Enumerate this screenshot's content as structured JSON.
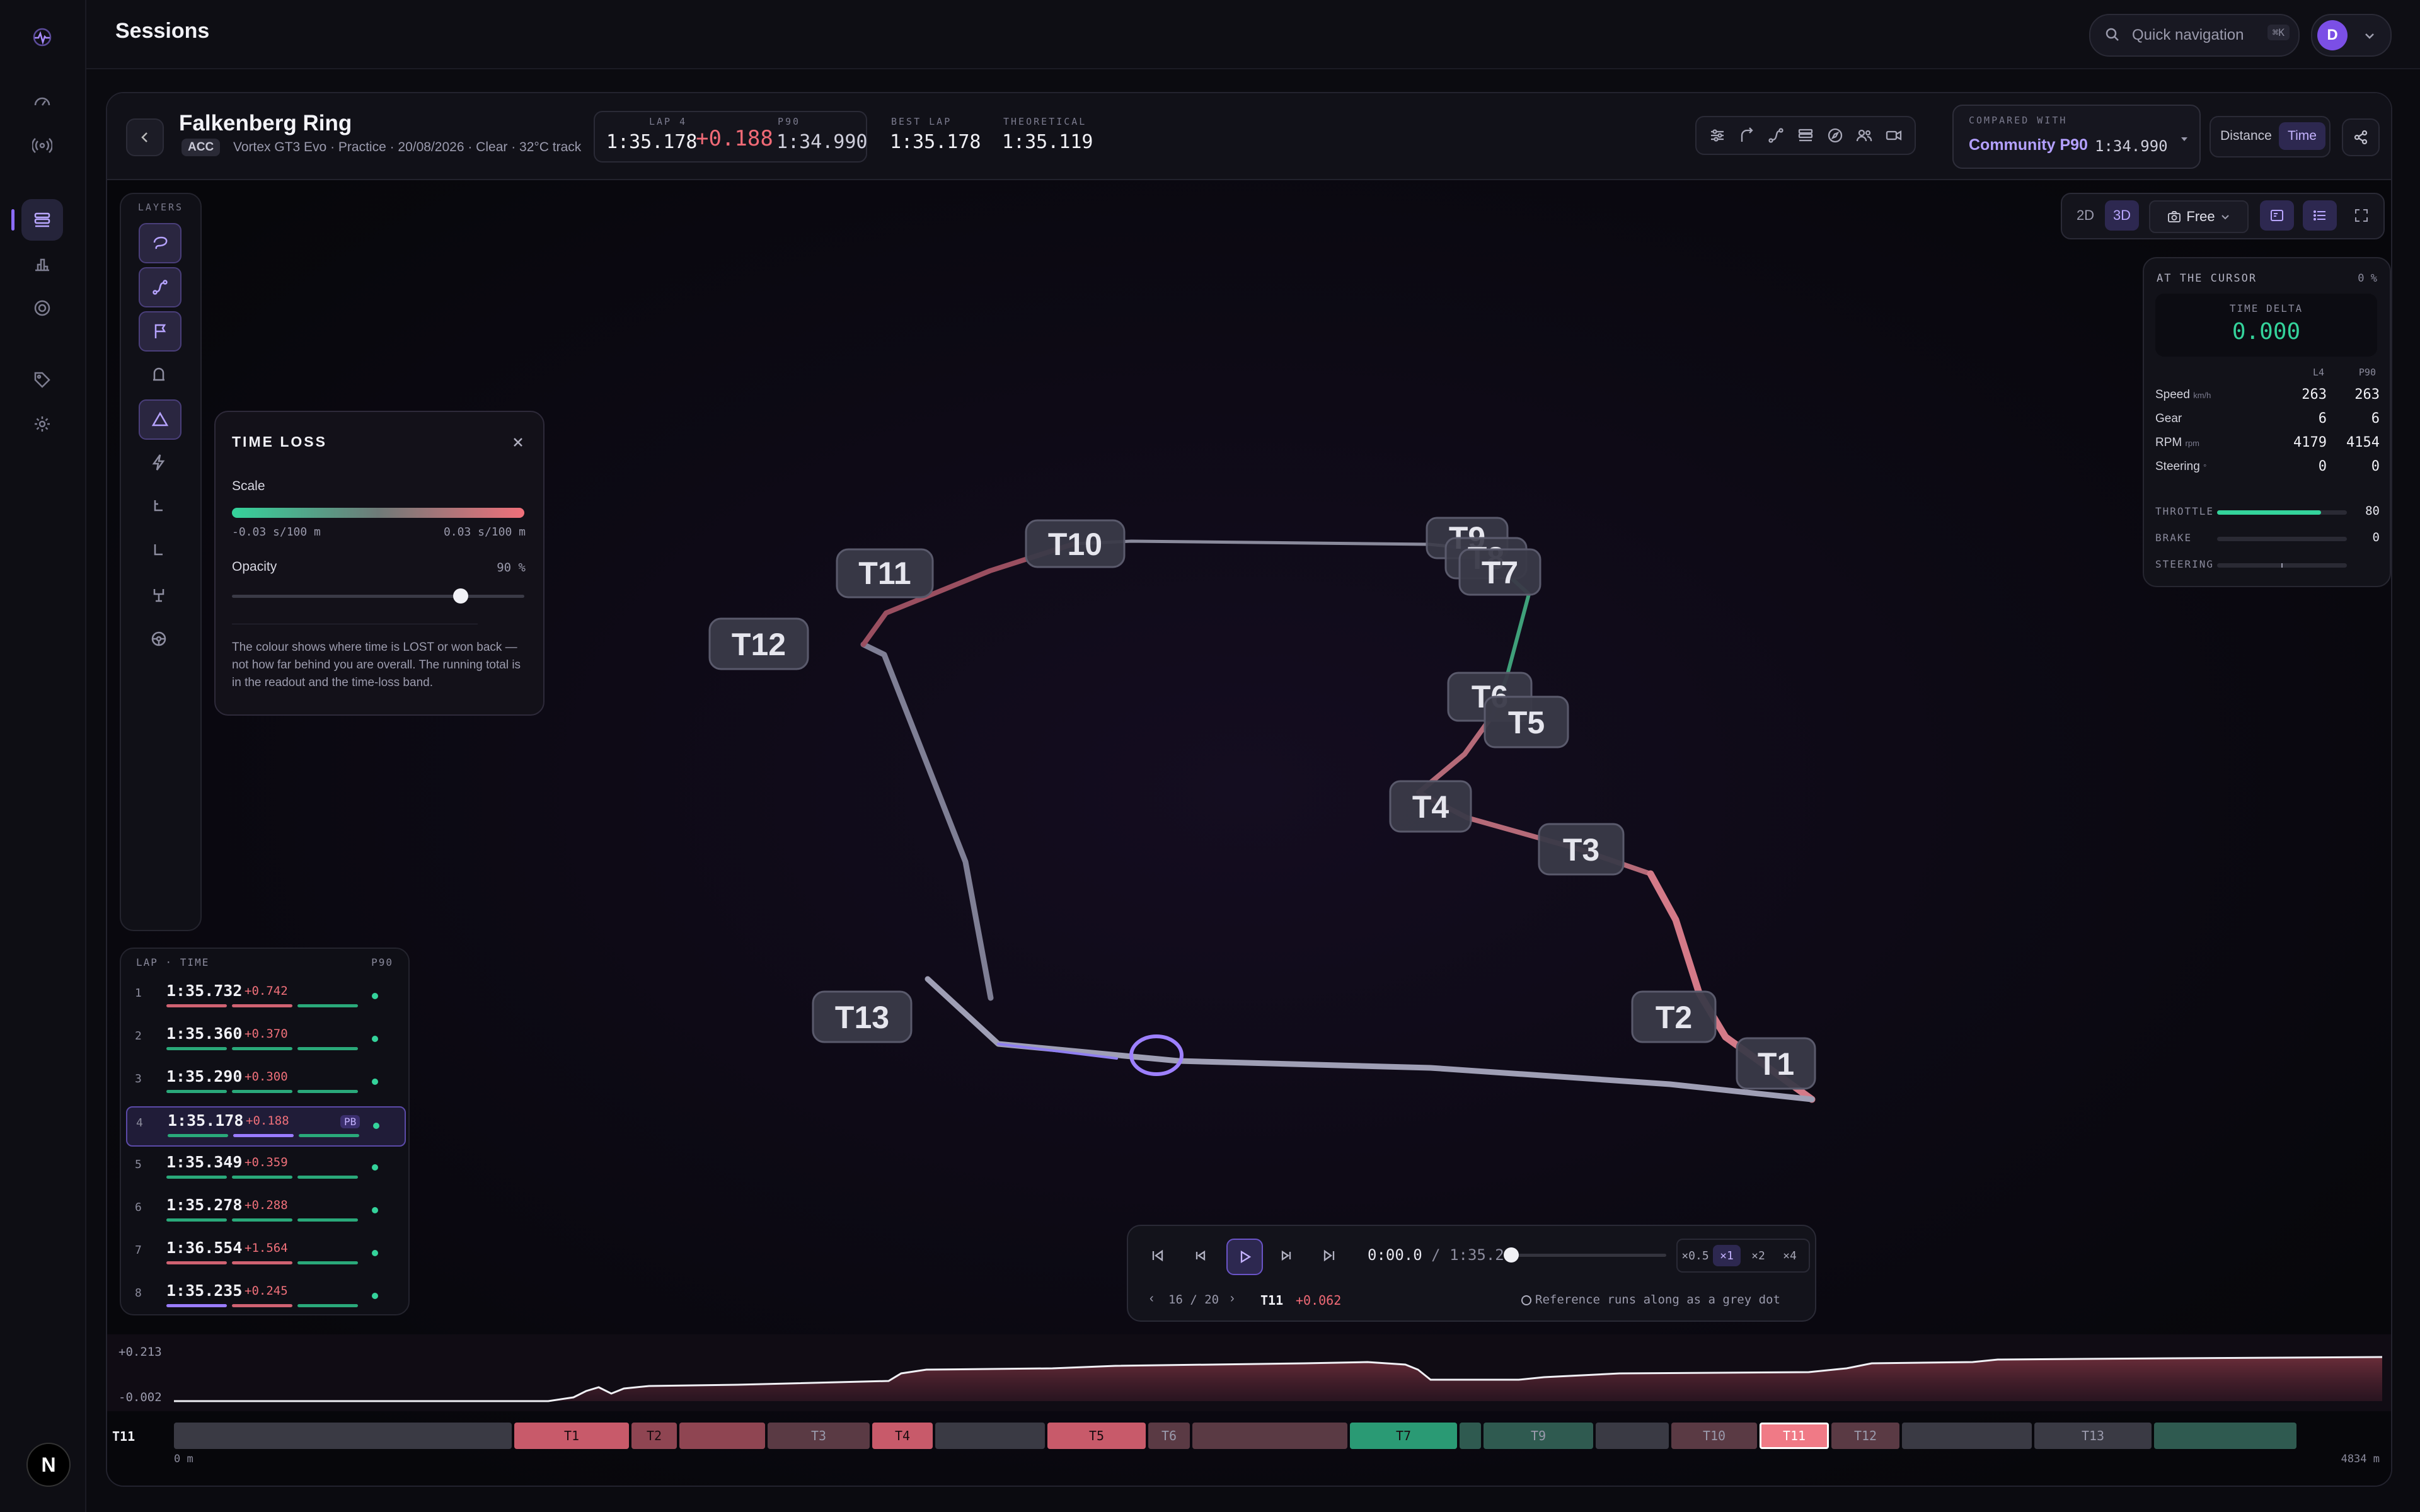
{
  "app": {
    "title": "Sessions",
    "quick_nav": "Quick navigation",
    "quick_nav_shortcut": "⌘K",
    "user_initial": "D",
    "footer_initial": "N"
  },
  "session": {
    "track": "Falkenberg Ring",
    "sim": "ACC",
    "meta": "Vortex GT3 Evo · Practice · 20/08/2026 · Clear · 32°C track",
    "lap_caption": "LAP 4",
    "lap_time": "1:35.178",
    "lap_delta": "+0.188",
    "ref_caption": "P90",
    "ref_time": "1:34.990",
    "best_caption": "BEST LAP",
    "best_time": "1:35.178",
    "theo_caption": "THEORETICAL",
    "theo_time": "1:35.119"
  },
  "compare": {
    "caption": "COMPARED WITH",
    "name": "Community P90",
    "time": "1:34.990"
  },
  "axis_toggle": {
    "distance": "Distance",
    "time": "Time",
    "selected": "Time"
  },
  "layers": {
    "title": "LAYERS"
  },
  "time_loss": {
    "title": "TIME LOSS",
    "scale_label": "Scale",
    "scale_min": "-0.03 s/100 m",
    "scale_max": "0.03 s/100 m",
    "opacity_label": "Opacity",
    "opacity_value": "90 %",
    "opacity_level": 0.9,
    "description": "The colour shows where time is LOST or won back — not how far behind you are overall. The running total is in the readout and the time-loss band.",
    "colors": {
      "gain": "#34d39b",
      "loss": "#f0707a"
    }
  },
  "lap_list": {
    "header_left": "LAP · TIME",
    "header_right": "P90",
    "laps": [
      {
        "num": "1",
        "time": "1:35.732",
        "delta": "+0.742",
        "sectors": [
          "loss",
          "loss",
          "gain"
        ]
      },
      {
        "num": "2",
        "time": "1:35.360",
        "delta": "+0.370",
        "sectors": [
          "gain",
          "gain",
          "gain"
        ]
      },
      {
        "num": "3",
        "time": "1:35.290",
        "delta": "+0.300",
        "sectors": [
          "gain",
          "gain",
          "gain"
        ]
      },
      {
        "num": "4",
        "time": "1:35.178",
        "delta": "+0.188",
        "sectors": [
          "gain",
          "best",
          "gain"
        ],
        "badge": "PB",
        "active": true
      },
      {
        "num": "5",
        "time": "1:35.349",
        "delta": "+0.359",
        "sectors": [
          "gain",
          "gain",
          "gain"
        ]
      },
      {
        "num": "6",
        "time": "1:35.278",
        "delta": "+0.288",
        "sectors": [
          "gain",
          "gain",
          "gain"
        ]
      },
      {
        "num": "7",
        "time": "1:36.554",
        "delta": "+1.564",
        "sectors": [
          "loss",
          "loss",
          "gain"
        ]
      },
      {
        "num": "8",
        "time": "1:35.235",
        "delta": "+0.245",
        "sectors": [
          "best",
          "loss",
          "gain"
        ]
      }
    ]
  },
  "view_mode": {
    "d2": "2D",
    "d3": "3D",
    "camera": "Free"
  },
  "cursor_panel": {
    "title": "AT THE CURSOR",
    "percent": "0 %",
    "delta_caption": "TIME DELTA",
    "delta_value": "0.000",
    "col_a": "L4",
    "col_b": "P90",
    "rows": [
      {
        "label": "Speed",
        "unit": "km/h",
        "a": "263",
        "b": "263"
      },
      {
        "label": "Gear",
        "unit": "",
        "a": "6",
        "b": "6"
      },
      {
        "label": "RPM",
        "unit": "rpm",
        "a": "4179",
        "b": "4154"
      },
      {
        "label": "Steering",
        "unit": "°",
        "a": "0",
        "b": "0"
      }
    ],
    "bars": [
      {
        "label": "THROTTLE",
        "value": "80",
        "level": 0.8
      },
      {
        "label": "BRAKE",
        "value": "0",
        "level": 0
      },
      {
        "label": "STEERING",
        "value": "",
        "level": 0.5
      }
    ]
  },
  "turns": [
    "T1",
    "T2",
    "T3",
    "T4",
    "T5",
    "T6",
    "T7",
    "T8",
    "T9",
    "T10",
    "T11",
    "T12",
    "T13"
  ],
  "player": {
    "time": "0:00.0",
    "duration": "1:35.2",
    "speeds": [
      "×0.5",
      "×1",
      "×2",
      "×4"
    ],
    "speed_selected": "×1",
    "page": "16 / 20",
    "corner": "T11",
    "corner_delta": "+0.062",
    "ref_note": "Reference runs along as a grey dot"
  },
  "delta_chart": {
    "y_max_label": "+0.213",
    "y_min_label": "-0.002"
  },
  "sector_strip": {
    "current": "T11",
    "start_label": "0 m",
    "end_label": "4834 m",
    "segments": [
      {
        "label": "",
        "state": "neutral"
      },
      {
        "label": "T1",
        "state": "loss"
      },
      {
        "label": "T2",
        "state": "loss-dim"
      },
      {
        "label": "",
        "state": "loss-dim"
      },
      {
        "label": "T3",
        "state": "neutral-warm"
      },
      {
        "label": "T4",
        "state": "loss"
      },
      {
        "label": "",
        "state": "neutral"
      },
      {
        "label": "T5",
        "state": "loss"
      },
      {
        "label": "T6",
        "state": "neutral-warm"
      },
      {
        "label": "",
        "state": "neutral-warm"
      },
      {
        "label": "T7",
        "state": "gain"
      },
      {
        "label": "",
        "state": "gain-dim"
      },
      {
        "label": "T9",
        "state": "gain-dim"
      },
      {
        "label": "",
        "state": "neutral"
      },
      {
        "label": "T10",
        "state": "neutral-warm"
      },
      {
        "label": "T11",
        "state": "selected"
      },
      {
        "label": "T12",
        "state": "neutral-warm"
      },
      {
        "label": "",
        "state": "neutral"
      },
      {
        "label": "T13",
        "state": "neutral"
      },
      {
        "label": "",
        "state": "gain-dim"
      }
    ]
  }
}
